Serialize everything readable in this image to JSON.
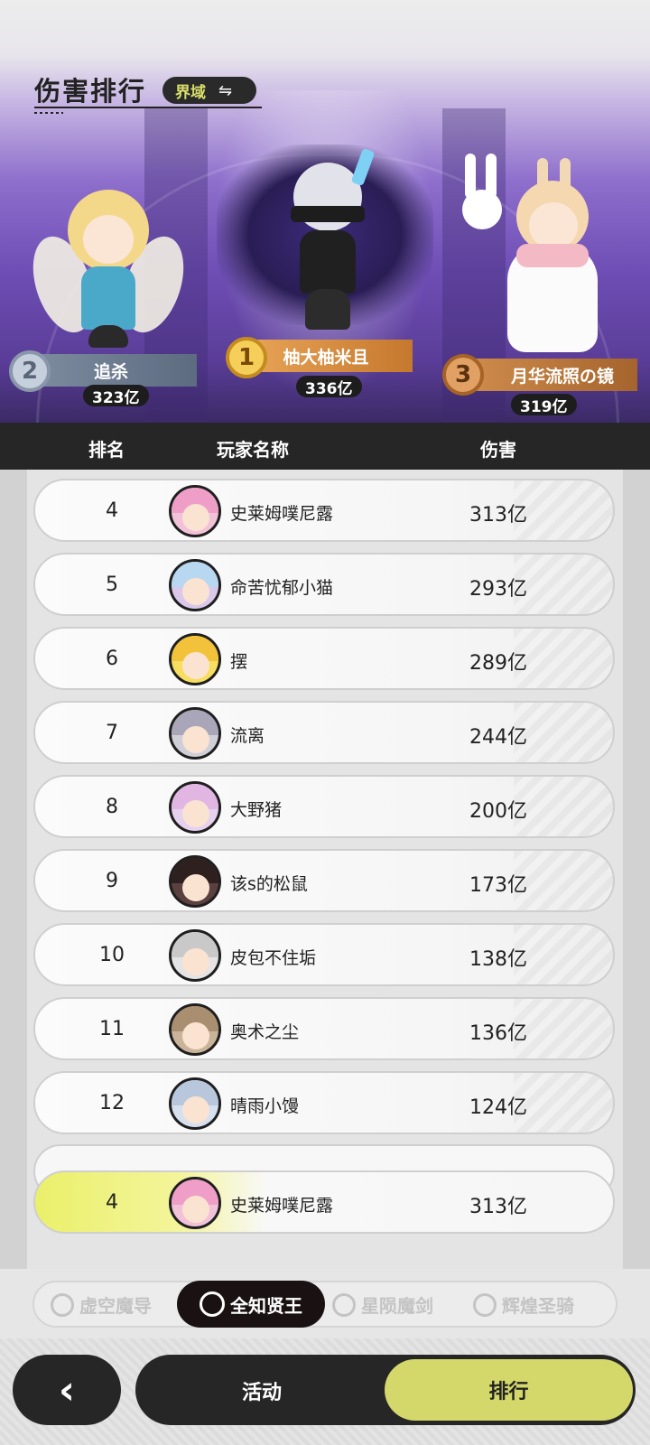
{
  "header": {
    "title": "伤害排行",
    "realm_label": "界域",
    "swap_icon": "⇋"
  },
  "podium": [
    {
      "rank": "2",
      "name": "追杀",
      "damage": "323亿"
    },
    {
      "rank": "1",
      "name": "柚大柚米且",
      "damage": "336亿"
    },
    {
      "rank": "3",
      "name": "月华流照の镜",
      "damage": "319亿"
    }
  ],
  "table": {
    "headers": {
      "rank": "排名",
      "player": "玩家名称",
      "damage": "伤害"
    },
    "rows": [
      {
        "rank": "4",
        "name": "史莱姆噗尼露",
        "damage": "313亿"
      },
      {
        "rank": "5",
        "name": "命苦忧郁小猫",
        "damage": "293亿"
      },
      {
        "rank": "6",
        "name": "摆",
        "damage": "289亿"
      },
      {
        "rank": "7",
        "name": "流离",
        "damage": "244亿"
      },
      {
        "rank": "8",
        "name": "大野猪",
        "damage": "200亿"
      },
      {
        "rank": "9",
        "name": "该s的松鼠",
        "damage": "173亿"
      },
      {
        "rank": "10",
        "name": "皮包不住垢",
        "damage": "138亿"
      },
      {
        "rank": "11",
        "name": "奥术之尘",
        "damage": "136亿"
      },
      {
        "rank": "12",
        "name": "晴雨小馒",
        "damage": "124亿"
      }
    ],
    "self": {
      "rank": "4",
      "name": "史莱姆噗尼露",
      "damage": "313亿"
    }
  },
  "class_tabs": [
    {
      "label": "虚空魔导",
      "active": false
    },
    {
      "label": "全知贤王",
      "active": true
    },
    {
      "label": "星陨魔剑",
      "active": false
    },
    {
      "label": "辉煌圣骑",
      "active": false
    }
  ],
  "bottom_nav": {
    "back_icon": "‹",
    "activity": "活动",
    "ranking": "排行"
  },
  "colors": {
    "accent": "#d4d86b",
    "dark": "#262626",
    "realm_text": "#d9df6a"
  }
}
